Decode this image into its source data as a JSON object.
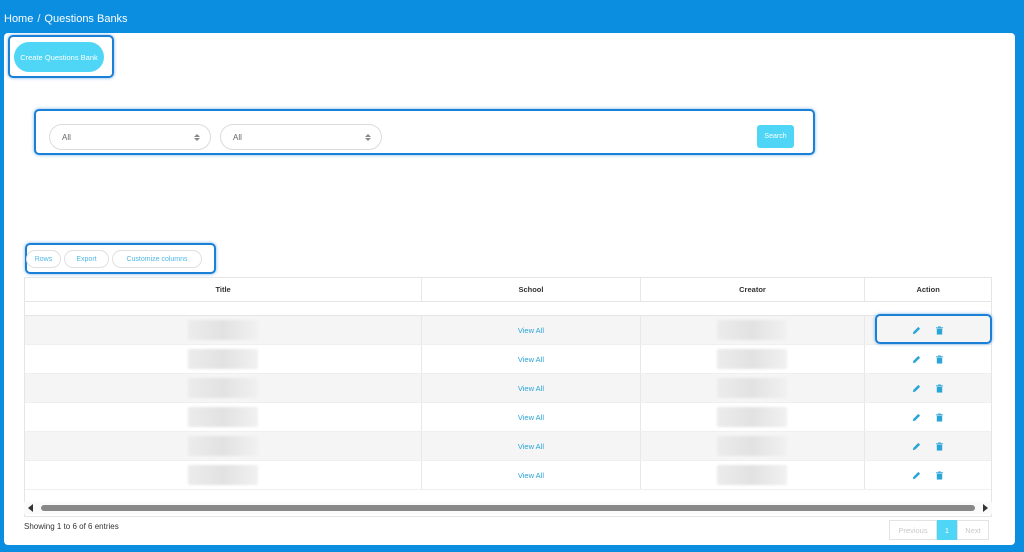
{
  "breadcrumb": {
    "home": "Home",
    "separator": "/",
    "current": "Questions Banks"
  },
  "toolbar": {
    "create_label": "Create Questions Bank"
  },
  "filters": {
    "select1_value": "All",
    "select2_value": "All",
    "search_label": "Search"
  },
  "table_tools": {
    "rows": "Rows",
    "export": "Export",
    "customize": "Customize columns"
  },
  "table": {
    "headers": {
      "title": "Title",
      "school": "School",
      "creator": "Creator",
      "action": "Action"
    },
    "rows": [
      {
        "school": "View All"
      },
      {
        "school": "View All"
      },
      {
        "school": "View All"
      },
      {
        "school": "View All"
      },
      {
        "school": "View All"
      },
      {
        "school": "View All"
      }
    ]
  },
  "footer": {
    "info": "Showing 1 to 6 of 6 entries",
    "previous": "Previous",
    "page": "1",
    "next": "Next"
  },
  "colors": {
    "accent": "#4fd6f7",
    "header_bg": "#0b8ee0",
    "link": "#2aa5d8",
    "highlight": "#1b7fd6"
  },
  "icons": {
    "edit": "pencil-icon",
    "delete": "trash-icon"
  }
}
